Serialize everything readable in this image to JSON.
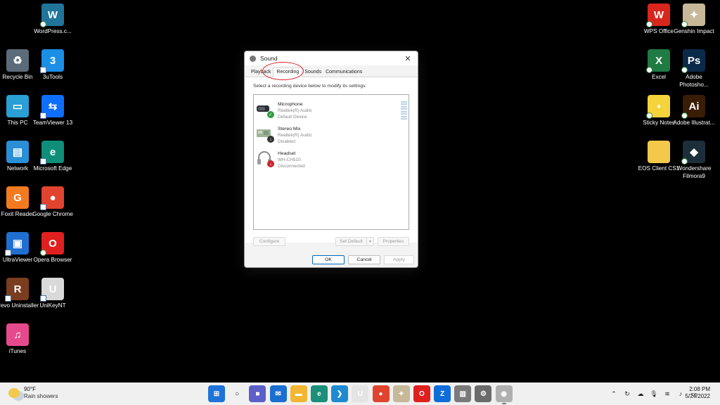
{
  "desktop": {
    "left_icons": [
      {
        "label": "WordPress.c...",
        "icon": "wordpress-icon",
        "color": "#21759b",
        "glyph": "W",
        "badge": "sync"
      },
      {
        "label": "Recycle Bin",
        "icon": "recycle-bin-icon",
        "color": "#5b6b7a",
        "glyph": "♻",
        "badge": ""
      },
      {
        "label": "3uTools",
        "icon": "3utools-icon",
        "color": "#1b8fe6",
        "glyph": "3",
        "badge": "arrow"
      },
      {
        "label": "This PC",
        "icon": "this-pc-icon",
        "color": "#2a9fd6",
        "glyph": "▭",
        "badge": ""
      },
      {
        "label": "TeamViewer 13",
        "icon": "teamviewer-icon",
        "color": "#0e6efd",
        "glyph": "⇆",
        "badge": "arrow"
      },
      {
        "label": "Network",
        "icon": "network-icon",
        "color": "#2a8fd6",
        "glyph": "▤",
        "badge": ""
      },
      {
        "label": "Microsoft Edge",
        "icon": "edge-icon",
        "color": "#0f8f7a",
        "glyph": "e",
        "badge": "arrow"
      },
      {
        "label": "Foxit Reader",
        "icon": "foxit-icon",
        "color": "#f47a20",
        "glyph": "G",
        "badge": ""
      },
      {
        "label": "Google Chrome",
        "icon": "chrome-icon",
        "color": "#e0442f",
        "glyph": "●",
        "badge": "arrow"
      },
      {
        "label": "UltraViewer",
        "icon": "ultraviewer-icon",
        "color": "#1f6fd1",
        "glyph": "▣",
        "badge": "arrow"
      },
      {
        "label": "Opera Browser",
        "icon": "opera-icon",
        "color": "#e0201f",
        "glyph": "O",
        "badge": "sync"
      },
      {
        "label": "Revo Uninstaller",
        "icon": "revo-uninstaller-icon",
        "color": "#7a3d1f",
        "glyph": "R",
        "badge": "arrow"
      },
      {
        "label": "UniKeyNT",
        "icon": "unikey-icon",
        "color": "#d9d9d9",
        "glyph": "U",
        "badge": "arrow"
      },
      {
        "label": "iTunes",
        "icon": "itunes-icon",
        "color": "#e64a8c",
        "glyph": "♫",
        "badge": ""
      }
    ],
    "right_icons": [
      {
        "label": "WPS Office",
        "icon": "wps-office-icon",
        "color": "#d9261c",
        "glyph": "W",
        "badge": "sync"
      },
      {
        "label": "Genshin Impact",
        "icon": "genshin-icon",
        "color": "#c7b89a",
        "glyph": "✦",
        "badge": "sync"
      },
      {
        "label": "Excel",
        "icon": "excel-icon",
        "color": "#1f7a44",
        "glyph": "X",
        "badge": "sync"
      },
      {
        "label": "Adobe Photosho...",
        "icon": "photoshop-icon",
        "color": "#0b2a4a",
        "glyph": "Ps",
        "badge": "sync"
      },
      {
        "label": "Sticky Notes",
        "icon": "sticky-notes-icon",
        "color": "#f5d33b",
        "glyph": "▪",
        "badge": "sync"
      },
      {
        "label": "Adobe Illustrat...",
        "icon": "illustrator-icon",
        "color": "#3a1d06",
        "glyph": "Ai",
        "badge": "sync"
      },
      {
        "label": "EOS Client CS1",
        "icon": "folder-icon",
        "color": "#f4c84a",
        "glyph": "",
        "badge": ""
      },
      {
        "label": "Wondershare Filmora9",
        "icon": "filmora-icon",
        "color": "#1c2e3a",
        "glyph": "◆",
        "badge": "sync"
      }
    ]
  },
  "dialog": {
    "title": "Sound",
    "close_glyph": "✕",
    "tabs": [
      "Playback",
      "Recording",
      "Sounds",
      "Communications"
    ],
    "active_tab": "Recording",
    "instruction": "Select a recording device below to modify its settings:",
    "devices": [
      {
        "name": "Microphone",
        "driver": "Realtek(R) Audio",
        "status": "Default Device",
        "icon": "microphone-device-icon",
        "badge_color": "#2e9b3f",
        "badge_glyph": "✓"
      },
      {
        "name": "Stereo Mix",
        "driver": "Realtek(R) Audio",
        "status": "Disabled",
        "icon": "stereo-mix-device-icon",
        "badge_color": "#333333",
        "badge_glyph": "↓"
      },
      {
        "name": "Headset",
        "driver": "WH-CH510",
        "status": "Disconnected",
        "icon": "headset-device-icon",
        "badge_color": "#c9252c",
        "badge_glyph": "↓"
      }
    ],
    "buttons": {
      "configure": "Configure",
      "set_default": "Set Default",
      "set_default_arrow": "▼",
      "properties": "Properties",
      "ok": "OK",
      "cancel": "Cancel",
      "apply": "Apply"
    }
  },
  "taskbar": {
    "weather_temp": "90°F",
    "weather_desc": "Rain showers",
    "apps": [
      {
        "icon": "start-icon",
        "color": "#1e73d8",
        "glyph": "⊞"
      },
      {
        "icon": "search-icon",
        "color": "#f0f0f0",
        "glyph": "○"
      },
      {
        "icon": "teams-chat-icon",
        "color": "#5b5fc7",
        "glyph": "■"
      },
      {
        "icon": "mail-icon",
        "color": "#1a6fd1",
        "glyph": "✉"
      },
      {
        "icon": "file-explorer-icon",
        "color": "#f2b632",
        "glyph": "▬"
      },
      {
        "icon": "edge-taskbar-icon",
        "color": "#1b8f7a",
        "glyph": "e"
      },
      {
        "icon": "vscode-icon",
        "color": "#1f8ad2",
        "glyph": "❯"
      },
      {
        "icon": "unikey-taskbar-icon",
        "color": "#e4e4e4",
        "glyph": "U"
      },
      {
        "icon": "chrome-taskbar-icon",
        "color": "#e0442f",
        "glyph": "●"
      },
      {
        "icon": "genshin-taskbar-icon",
        "color": "#c7b89a",
        "glyph": "✦"
      },
      {
        "icon": "opera-taskbar-icon",
        "color": "#e0201f",
        "glyph": "O"
      },
      {
        "icon": "zalo-icon",
        "color": "#0f6dd9",
        "glyph": "Z"
      },
      {
        "icon": "printer-icon",
        "color": "#7a7a7a",
        "glyph": "▥"
      },
      {
        "icon": "settings-icon",
        "color": "#6b6b6b",
        "glyph": "⚙"
      },
      {
        "icon": "sound-control-icon",
        "color": "#b0b0b0",
        "glyph": "◉"
      }
    ],
    "tray": [
      {
        "icon": "chevron-up-icon",
        "glyph": "⌃"
      },
      {
        "icon": "sync-tray-icon",
        "glyph": "↻"
      },
      {
        "icon": "cloud-tray-icon",
        "glyph": "☁"
      },
      {
        "icon": "microphone-tray-icon",
        "glyph": "🎙"
      },
      {
        "icon": "wifi-icon",
        "glyph": "≋"
      },
      {
        "icon": "volume-icon",
        "glyph": "♪"
      },
      {
        "icon": "battery-icon",
        "glyph": "▭"
      }
    ],
    "time": "2:08 PM",
    "date": "5/24/2022"
  }
}
